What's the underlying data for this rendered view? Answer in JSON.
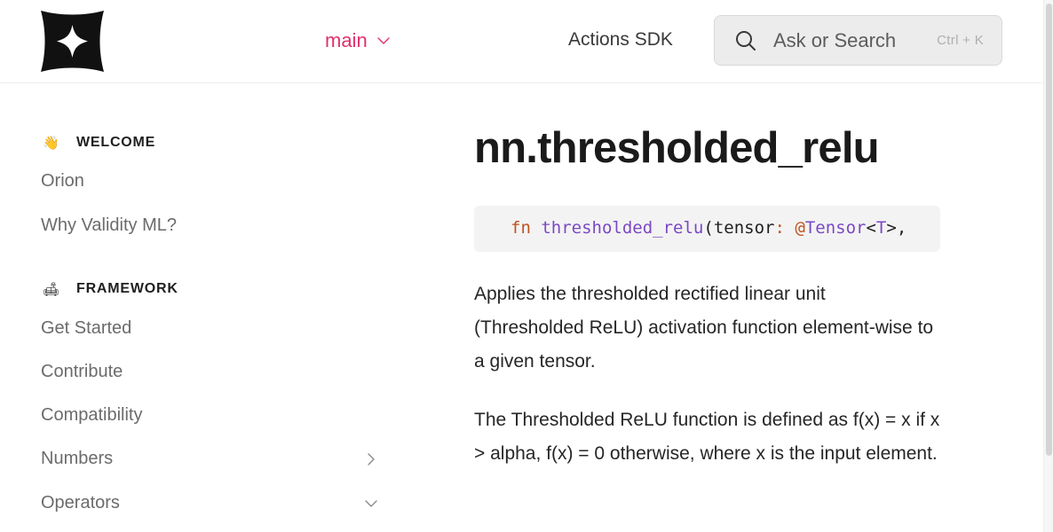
{
  "header": {
    "logo_icon": "gitbook-star-logo",
    "branch_label": "main",
    "sdk_link": "Actions SDK",
    "search": {
      "placeholder": "Ask or Search",
      "shortcut": "Ctrl + K"
    }
  },
  "sidebar": {
    "sections": [
      {
        "emoji": "👋",
        "title": "WELCOME",
        "items": [
          {
            "label": "Orion"
          },
          {
            "label": "Why Validity ML?"
          }
        ]
      },
      {
        "emoji": "🛋",
        "title": "FRAMEWORK",
        "items": [
          {
            "label": "Get Started"
          },
          {
            "label": "Contribute"
          },
          {
            "label": "Compatibility"
          },
          {
            "label": "Numbers",
            "chevron": "chevron-right-icon"
          },
          {
            "label": "Operators",
            "chevron": "chevron-down-icon"
          }
        ]
      }
    ]
  },
  "main": {
    "title": "nn.thresholded_relu",
    "code": {
      "kw": "fn",
      "fn": "thresholded_relu",
      "open": "(",
      "param": "tensor",
      "colon": ":",
      "at": "@",
      "type": "Tensor",
      "lt": "<",
      "generic": "T",
      "gt": ">,"
    },
    "paragraphs": [
      "Applies the thresholded rectified linear unit (Thresholded ReLU) activation function element-wise to a given tensor.",
      "The Thresholded ReLU function is defined as f(x) = x if x > alpha, f(x) = 0 otherwise, where x is the input element."
    ]
  },
  "colors": {
    "accent": "#e0316a",
    "code_keyword": "#c0531f",
    "code_function": "#7b48c4"
  }
}
